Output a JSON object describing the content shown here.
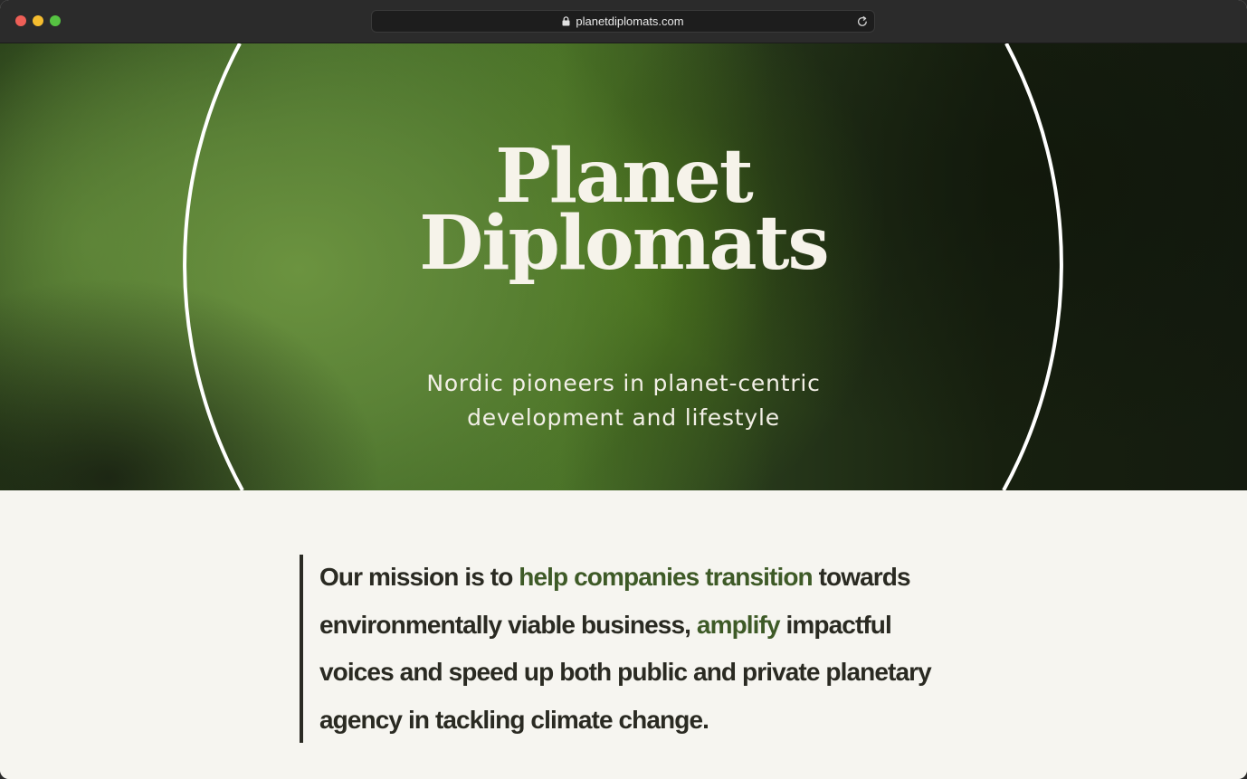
{
  "browser": {
    "url": "planetdiplomats.com"
  },
  "hero": {
    "title_line1": "Planet",
    "title_line2": "Diplomats",
    "subtitle_line1": "Nordic pioneers in planet-centric",
    "subtitle_line2": "development and lifestyle"
  },
  "mission": {
    "seg1": "Our mission is to ",
    "seg2": "help companies transition",
    "seg3": " towards environmentally viable business, ",
    "seg4": "amplify",
    "seg5": " impactful voices and speed up both public and private planetary agency in tackling climate change."
  },
  "colors": {
    "accent_text": "#3e5a27",
    "body_text": "#2a2a22",
    "hero_text": "#f6f3ea",
    "page_background": "#f6f5f0"
  },
  "icons": {
    "lock": "lock-icon",
    "reload": "reload-icon"
  }
}
